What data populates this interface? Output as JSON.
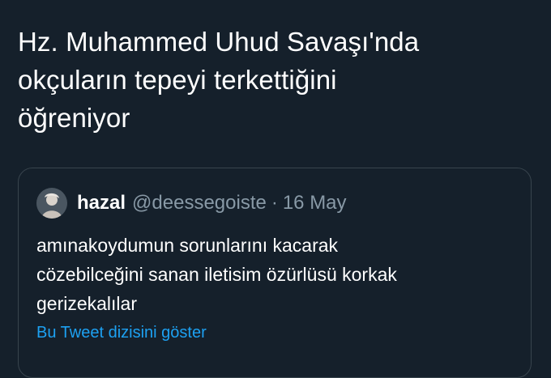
{
  "tweet": {
    "text_lines": [
      "Hz. Muhammed Uhud Savaşı'nda",
      "okçuların tepeyi terkettiğini",
      "öğreniyor"
    ]
  },
  "quoted_tweet": {
    "avatar_icon": "user-avatar",
    "display_name": "hazal",
    "handle": "@deessegoiste",
    "separator": "·",
    "date": "16 May",
    "text_lines": [
      "amınakoydumun sorunlarını kacarak",
      "cözebilceğini sanan iletisim özürlüsü korkak",
      "gerizekalılar"
    ],
    "thread_link": "Bu Tweet dizisini göster"
  },
  "colors": {
    "background": "#15202b",
    "text_primary": "#ffffff",
    "text_secondary": "#8899a6",
    "link": "#1da1f2",
    "border": "#38444d"
  }
}
